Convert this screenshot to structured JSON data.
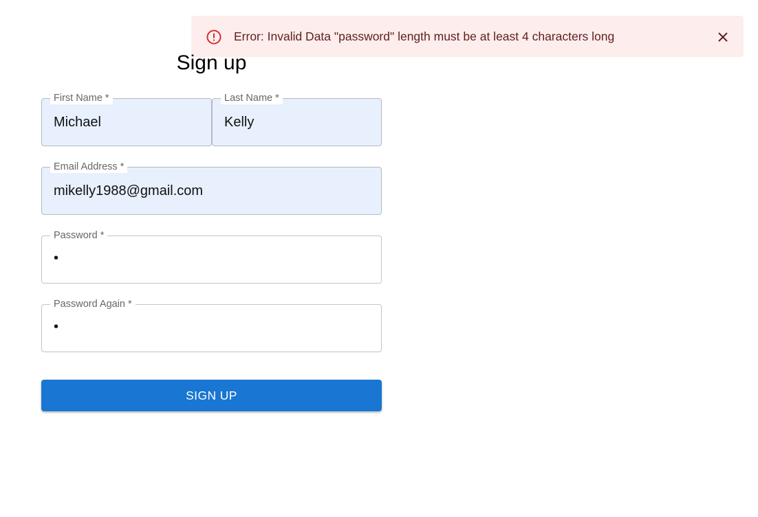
{
  "alert": {
    "severity": "error",
    "icon": "error-outline-icon",
    "message": "Error: Invalid Data \"password\" length must be at least 4 characters long",
    "close_icon": "close-icon",
    "colors": {
      "background": "#fdeded",
      "text": "#5f2120",
      "icon": "#d32f2f"
    }
  },
  "form": {
    "title": "Sign up",
    "fields": {
      "first_name": {
        "label": "First Name *",
        "value": "Michael"
      },
      "last_name": {
        "label": "Last Name *",
        "value": "Kelly"
      },
      "email": {
        "label": "Email Address *",
        "value": "mikelly1988@gmail.com"
      },
      "password": {
        "label": "Password *",
        "value": "•"
      },
      "password_again": {
        "label": "Password Again *",
        "value": "•"
      }
    },
    "submit_label": "SIGN UP",
    "colors": {
      "primary": "#1976d2",
      "autofill_bg": "#e8f0fe"
    }
  }
}
